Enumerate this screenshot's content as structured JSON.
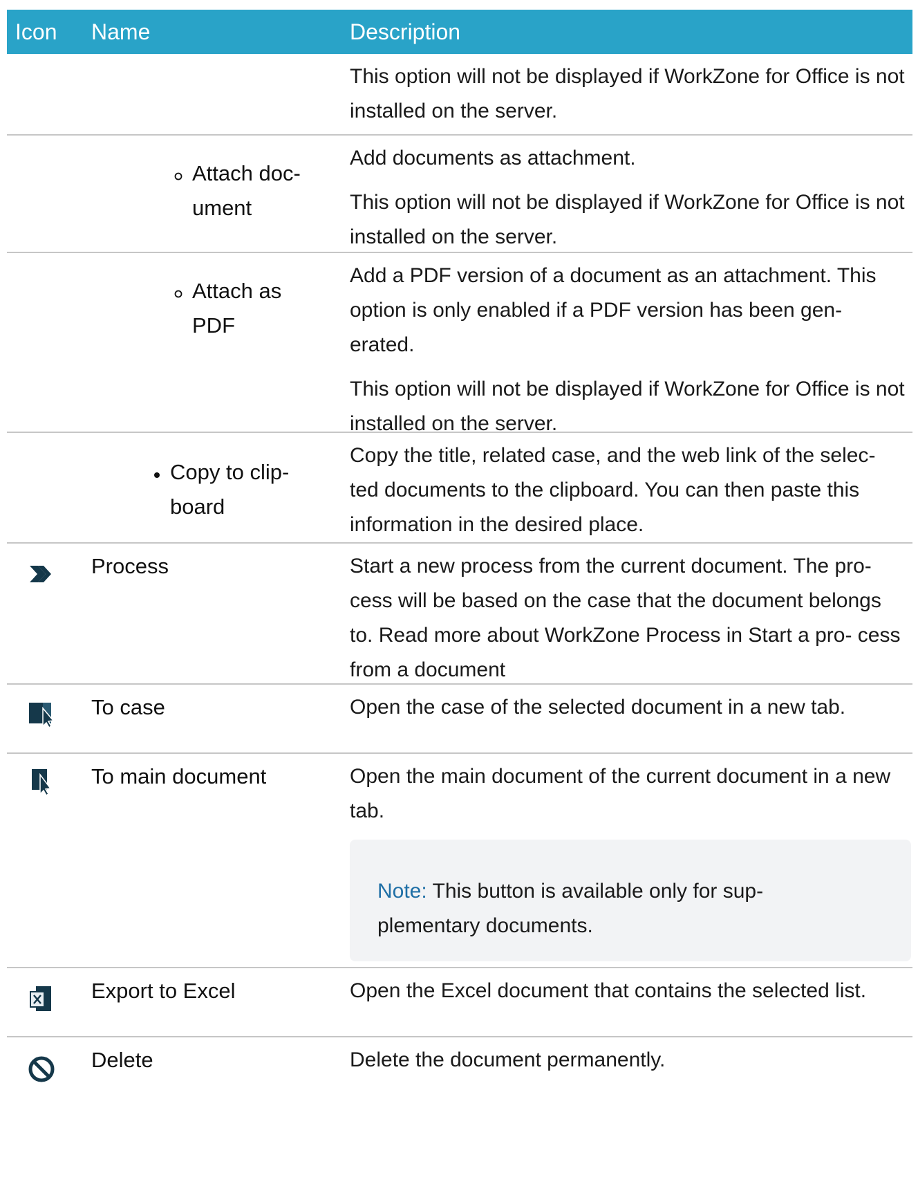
{
  "header": {
    "icon": "Icon",
    "name": "Name",
    "description": "Description"
  },
  "rows": [
    {
      "desc1": "This option will not be displayed if WorkZone for Office is not installed on the server."
    },
    {
      "name_line1": "Attach doc-",
      "name_line2": "ument",
      "desc1": "Add documents as attachment.",
      "desc2": "This option will not be displayed if WorkZone for Office is not installed on the server."
    },
    {
      "name_line1": "Attach as",
      "name_line2": "PDF",
      "desc1": "Add a PDF version of a document as an attachment. This option is only enabled if a PDF version has been gen- erated.",
      "desc2": "This option will not be displayed if WorkZone for Office is not installed on the server."
    },
    {
      "name_line1": "Copy to clip-",
      "name_line2": "board",
      "desc1": "Copy the title, related case, and the web link of the selec- ted documents to the clipboard. You can then paste this information in the desired place."
    },
    {
      "icon": "process-chevron-icon",
      "name": "Process",
      "desc1": "Start a new process from the current document. The pro- cess will be based on the case that the document belongs to. Read more about WorkZone Process in Start a pro- cess from a document"
    },
    {
      "icon": "to-case-icon",
      "name": "To case",
      "desc1": "Open the case of the selected document in a new tab."
    },
    {
      "icon": "to-main-document-icon",
      "name": "To main document",
      "desc1": "Open the main document of the current document in a new tab.",
      "note_label": "Note:",
      "note_text": " This button is available only for sup- plementary documents."
    },
    {
      "icon": "excel-icon",
      "name": "Export to Excel",
      "desc1": "Open the Excel document that contains the selected list."
    },
    {
      "icon": "delete-prohibited-icon",
      "name": "Delete",
      "desc1": "Delete the document permanently."
    }
  ],
  "colors": {
    "header_bg": "#29a3c8",
    "icon_dark": "#15384a",
    "note_label": "#1f6fa6"
  }
}
